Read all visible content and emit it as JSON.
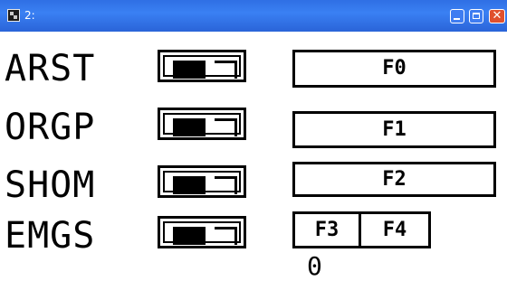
{
  "window": {
    "title": "2:",
    "icon": "app-icon",
    "controls": [
      "minimize-icon",
      "maximize-icon",
      "close-icon"
    ],
    "close_glyph": "✕"
  },
  "rows": [
    {
      "label": "ARST",
      "state": "off"
    },
    {
      "label": "ORGP",
      "state": "off"
    },
    {
      "label": "SHOM",
      "state": "off"
    },
    {
      "label": "EMGS",
      "state": "off"
    }
  ],
  "function_buttons": [
    "F0",
    "F1",
    "F2",
    "F3",
    "F4"
  ],
  "value_readout": "0",
  "colors": {
    "titlebar": "#2f6fe4",
    "close": "#e0502e",
    "ink": "#000000",
    "background": "#ffffff"
  }
}
